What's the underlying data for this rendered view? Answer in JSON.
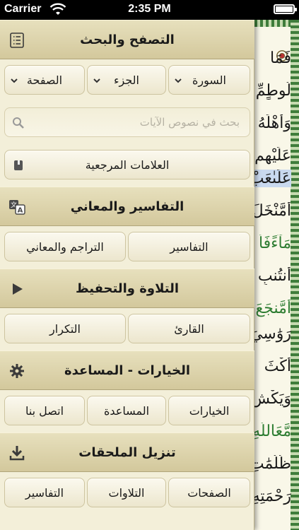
{
  "status_bar": {
    "carrier": "Carrier",
    "time": "2:35 PM"
  },
  "browse": {
    "title": "التصفح والبحث",
    "icon": "list-icon",
    "selectors": [
      {
        "label": "السورة"
      },
      {
        "label": "الجزء"
      },
      {
        "label": "الصفحة"
      }
    ],
    "search_placeholder": "بحث في نصوص الآيات",
    "bookmarks_label": "العلامات المرجعية"
  },
  "tafsir": {
    "title": "التفاسير والمعاني",
    "icon": "translate-icon",
    "buttons": [
      "التفاسير",
      "التراجم والمعاني"
    ]
  },
  "recitation": {
    "title": "التلاوة والتحفيظ",
    "icon": "play-icon",
    "buttons": [
      "القارئ",
      "التكرار"
    ]
  },
  "options": {
    "title": "الخيارات - المساعدة",
    "icon": "gear-icon",
    "buttons": [
      "الخيارات",
      "المساعدة",
      "اتصل بنا"
    ]
  },
  "downloads": {
    "title": "تنزيل الملحقات",
    "icon": "download-icon",
    "buttons": [
      "الصفحات",
      "التلاوات",
      "التفاسير"
    ]
  },
  "quran_lines": [
    "فَمَا",
    "لُوطٍمِّ",
    "وَأَهْلَهُ",
    "عَلَيْهِم",
    "عَلَىٰعَبْ",
    "أَمَّنْخَلَ",
    "مَآءًفَأَ",
    "أَنتُنبِ",
    "أَمَّنجَعَ",
    "رَوَٰسِيَ",
    "أَكْثَ",
    "وَيَكْشِ",
    "مَّعَاللَّهِ",
    "ظُلُمَٰتِ",
    "رَحْمَتِهِ"
  ],
  "colors": {
    "panel_bg": "#f3efd9",
    "header_gradient_top": "#e7e0bd",
    "header_gradient_bottom": "#d3c89c",
    "page_border": "#3f7d3b",
    "highlight": "#c9d9ef"
  }
}
